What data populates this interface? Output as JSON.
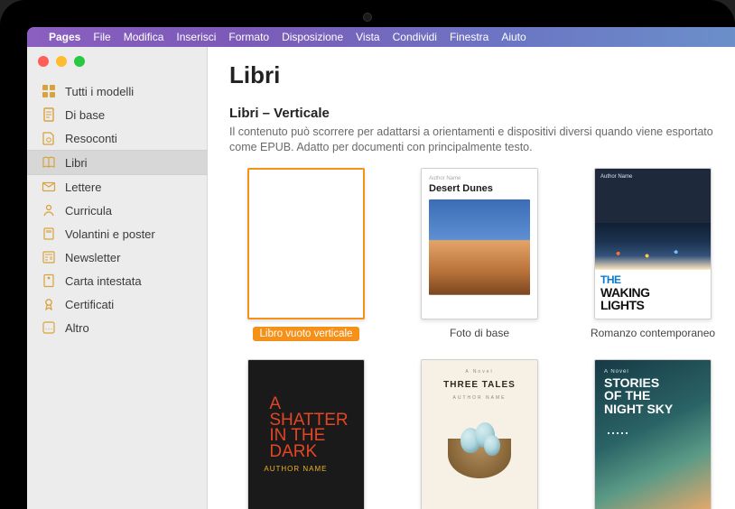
{
  "menubar": {
    "items": [
      {
        "label": "Pages",
        "bold": true
      },
      {
        "label": "File"
      },
      {
        "label": "Modifica"
      },
      {
        "label": "Inserisci"
      },
      {
        "label": "Formato"
      },
      {
        "label": "Disposizione"
      },
      {
        "label": "Vista"
      },
      {
        "label": "Condividi"
      },
      {
        "label": "Finestra"
      },
      {
        "label": "Aiuto"
      }
    ]
  },
  "sidebar": {
    "items": [
      {
        "icon": "grid-icon",
        "label": "Tutti i modelli",
        "selected": false
      },
      {
        "icon": "doc-icon",
        "label": "Di base",
        "selected": false
      },
      {
        "icon": "report-icon",
        "label": "Resoconti",
        "selected": false
      },
      {
        "icon": "book-icon",
        "label": "Libri",
        "selected": true
      },
      {
        "icon": "envelope-icon",
        "label": "Lettere",
        "selected": false
      },
      {
        "icon": "person-icon",
        "label": "Curricula",
        "selected": false
      },
      {
        "icon": "flyer-icon",
        "label": "Volantini e poster",
        "selected": false
      },
      {
        "icon": "newsletter-icon",
        "label": "Newsletter",
        "selected": false
      },
      {
        "icon": "letterhead-icon",
        "label": "Carta intestata",
        "selected": false
      },
      {
        "icon": "badge-icon",
        "label": "Certificati",
        "selected": false
      },
      {
        "icon": "more-icon",
        "label": "Altro",
        "selected": false
      }
    ]
  },
  "content": {
    "title": "Libri",
    "section_title": "Libri – Verticale",
    "section_desc": "Il contenuto può scorrere per adattarsi a orientamenti e dispositivi diversi quando viene esportato come EPUB. Adatto per documenti con principalmente testo.",
    "templates_row1": [
      {
        "id": "blank-portrait",
        "label": "Libro vuoto verticale",
        "selected": true
      },
      {
        "id": "desert-dunes",
        "label": "Foto di base",
        "selected": false,
        "cover": {
          "author": "Author Name",
          "title": "Desert Dunes"
        }
      },
      {
        "id": "waking-lights",
        "label": "Romanzo contemporaneo",
        "selected": false,
        "cover": {
          "author": "Author Name",
          "line1": "THE",
          "line2": "WAKING",
          "line3": "LIGHTS"
        }
      },
      {
        "id": "sliver",
        "label": "",
        "selected": false
      }
    ],
    "templates_row2": [
      {
        "id": "shatter",
        "cover": {
          "l1": "A",
          "l2": "SHATTER",
          "l3": "IN THE",
          "l4": "DARK",
          "author": "AUTHOR NAME"
        }
      },
      {
        "id": "three-tales",
        "cover": {
          "pre": "A Novel",
          "title": "THREE TALES",
          "author": "AUTHOR NAME"
        }
      },
      {
        "id": "night-sky",
        "cover": {
          "pre": "A Novel",
          "l1": "STORIES",
          "l2": "OF THE",
          "l3": "NIGHT SKY"
        }
      },
      {
        "id": "sliver2"
      }
    ]
  },
  "colors": {
    "accent": "#f59019"
  }
}
